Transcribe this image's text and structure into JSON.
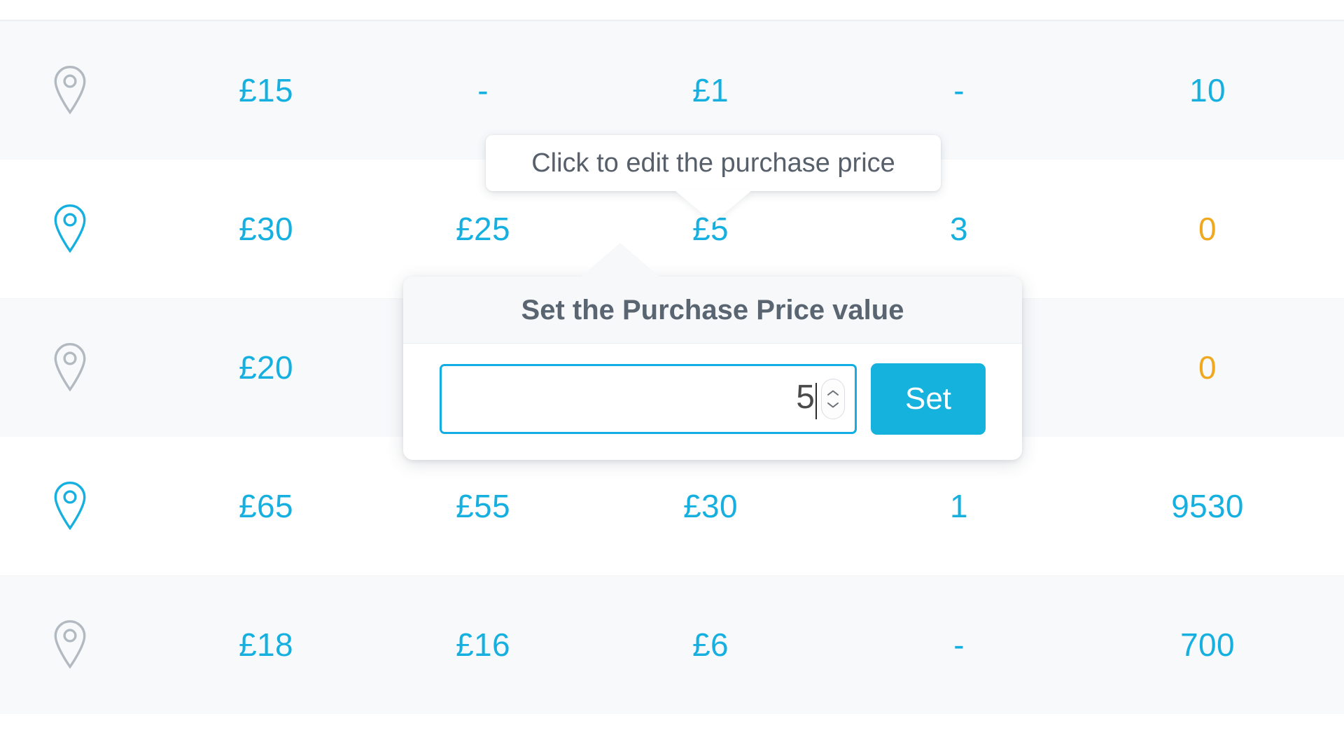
{
  "table": {
    "row_values_color": "#16b0e0",
    "warning_color": "#f0a81e",
    "rows": [
      {
        "pin": "map-pin-icon",
        "pin_state": "inactive",
        "striped": true,
        "c1": "£15",
        "c2": "-",
        "c3": "£1",
        "c4": "-",
        "c5": "10",
        "c5_state": "normal"
      },
      {
        "pin": "map-pin-icon",
        "pin_state": "active",
        "striped": false,
        "c1": "£30",
        "c2": "£25",
        "c3": "£5",
        "c4": "3",
        "c5": "0",
        "c5_state": "warning"
      },
      {
        "pin": "map-pin-icon",
        "pin_state": "inactive",
        "striped": true,
        "c1": "£20",
        "c2": "",
        "c3": "",
        "c4": "",
        "c5": "0",
        "c5_state": "warning"
      },
      {
        "pin": "map-pin-icon",
        "pin_state": "active",
        "striped": false,
        "c1": "£65",
        "c2": "£55",
        "c3": "£30",
        "c4": "1",
        "c5": "9530",
        "c5_state": "normal"
      },
      {
        "pin": "map-pin-icon",
        "pin_state": "inactive",
        "striped": true,
        "c1": "£18",
        "c2": "£16",
        "c3": "£6",
        "c4": "-",
        "c5": "700",
        "c5_state": "normal"
      }
    ]
  },
  "tooltip": {
    "text": "Click to edit the purchase price"
  },
  "popover": {
    "title": "Set the Purchase Price value",
    "input_value": "5",
    "input_placeholder": "",
    "set_label": "Set",
    "accent_color": "#14b2dd"
  }
}
